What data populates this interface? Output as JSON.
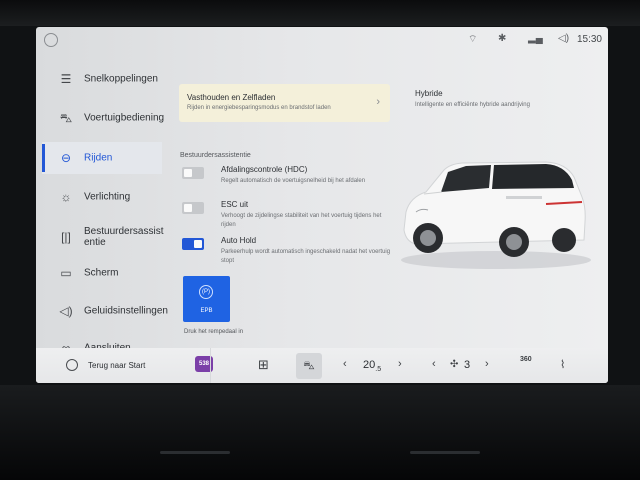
{
  "status": {
    "time": "15:30",
    "icons": [
      "avatar-icon",
      "wifi-icon",
      "bluetooth-icon",
      "signal-icon",
      "volume-icon"
    ]
  },
  "sidebar": {
    "items": [
      {
        "label": "Snelkoppelingen",
        "icon": "shortcuts-icon",
        "active": false
      },
      {
        "label": "Voertuigbediening",
        "icon": "car-control-icon",
        "active": false
      },
      {
        "label": "Rijden",
        "icon": "steering-wheel-icon",
        "active": true
      },
      {
        "label": "Verlichting",
        "icon": "light-icon",
        "active": false
      },
      {
        "label": "Bestuurdersassist entie",
        "icon": "driver-assist-icon",
        "active": false
      },
      {
        "label": "Scherm",
        "icon": "screen-icon",
        "active": false
      },
      {
        "label": "Geluidsinstellingen",
        "icon": "speaker-icon",
        "active": false
      },
      {
        "label": "Aansluiten",
        "icon": "link-icon",
        "active": false
      }
    ]
  },
  "main": {
    "mode_card": {
      "title": "Vasthouden en Zelfladen",
      "subtitle": "Rijden in energiebesparingsmodus en brandstof laden"
    },
    "section_title": "Bestuurdersassistentie",
    "toggles": [
      {
        "title": "Afdalingscontrole (HDC)",
        "description": "Regelt automatisch de voertuigsnelheid bij het afdalen",
        "state": "off"
      },
      {
        "title": "ESC uit",
        "description": "Verhoogt de zijdelingse stabiliteit van het voertuig tijdens het rijden",
        "state": "off"
      },
      {
        "title": "Auto Hold",
        "description": "Parkeerhulp wordt automatisch ingeschakeld nadat het voertuig stopt",
        "state": "on"
      }
    ],
    "epb": {
      "label": "EPB",
      "icon_text": "(P)",
      "hint": "Druk het rempedaal in"
    }
  },
  "mode_panel": {
    "title": "Hybride",
    "description": "Intelligente en efficiënte hybride aandrijving"
  },
  "bottom_bar": {
    "home_label": "Terug naar Start",
    "badge": "538",
    "temperature_main": "20",
    "temperature_decimal": ".5",
    "fan_level": "3",
    "camera_label": "360"
  },
  "colors": {
    "accent": "#2257D6",
    "epb_tile": "#1F63E3",
    "mode_card": "#F4F0DA",
    "badge": "#7B3FA8"
  }
}
